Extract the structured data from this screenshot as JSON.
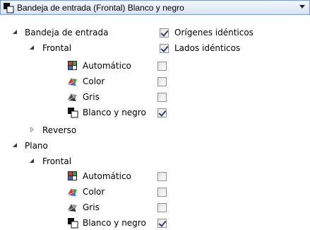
{
  "dropdown": {
    "selected": "Bandeja de entrada (Frontal) Blanco y negro",
    "icon": "black-white-icon"
  },
  "tree": {
    "inbox": {
      "label": "Bandeja de entrada",
      "options": {
        "identical_origins": {
          "label": "Orígenes idénticos",
          "checked": true
        },
        "identical_sides": {
          "label": "Lados idénticos",
          "checked": true
        }
      },
      "front": {
        "label": "Frontal",
        "modes": [
          {
            "label": "Automático",
            "icon": "auto-mode-icon",
            "checked": false
          },
          {
            "label": "Color",
            "icon": "color-mode-icon",
            "checked": false
          },
          {
            "label": "Gris",
            "icon": "gray-mode-icon",
            "checked": false
          },
          {
            "label": "Blanco y negro",
            "icon": "black-white-icon",
            "checked": true
          }
        ]
      },
      "reverse": {
        "label": "Reverso"
      }
    },
    "flatbed": {
      "label": "Plano",
      "front": {
        "label": "Frontal",
        "modes": [
          {
            "label": "Automático",
            "icon": "auto-mode-icon",
            "checked": false
          },
          {
            "label": "Color",
            "icon": "color-mode-icon",
            "checked": false
          },
          {
            "label": "Gris",
            "icon": "gray-mode-icon",
            "checked": false
          },
          {
            "label": "Blanco y negro",
            "icon": "black-white-icon",
            "checked": true
          }
        ]
      }
    }
  },
  "colors": {
    "combo_border": "#7a9bc7",
    "check_mark": "#2a3f7a",
    "color_icon_red": "#e8322b",
    "color_icon_green": "#3aa63a",
    "color_icon_blue": "#2f6fd6"
  }
}
